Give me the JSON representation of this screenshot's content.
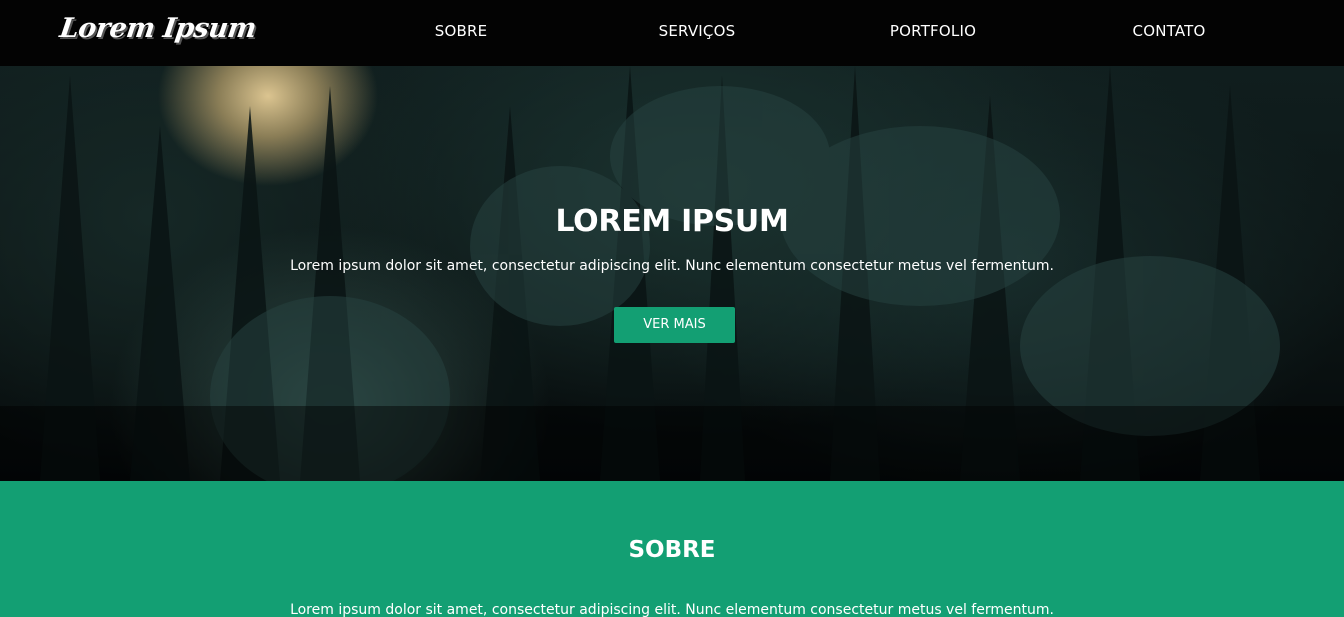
{
  "brand": {
    "logo_text": "Lorem Ipsum"
  },
  "nav": {
    "items": [
      {
        "label": "SOBRE"
      },
      {
        "label": "SERVIÇOS"
      },
      {
        "label": "PORTFOLIO"
      },
      {
        "label": "CONTATO"
      }
    ]
  },
  "hero": {
    "title": "LOREM IPSUM",
    "text": "Lorem ipsum dolor sit amet, consectetur adipiscing elit. Nunc elementum consectetur metus vel fermentum.",
    "button_label": "VER MAIS",
    "background": "dark-forest-photo"
  },
  "about": {
    "title": "SOBRE",
    "text": "Lorem ipsum dolor sit amet, consectetur adipiscing elit. Nunc elementum consectetur metus vel fermentum."
  },
  "colors": {
    "navbar": "#030303",
    "accent": "#139f73",
    "text": "#ffffff"
  }
}
